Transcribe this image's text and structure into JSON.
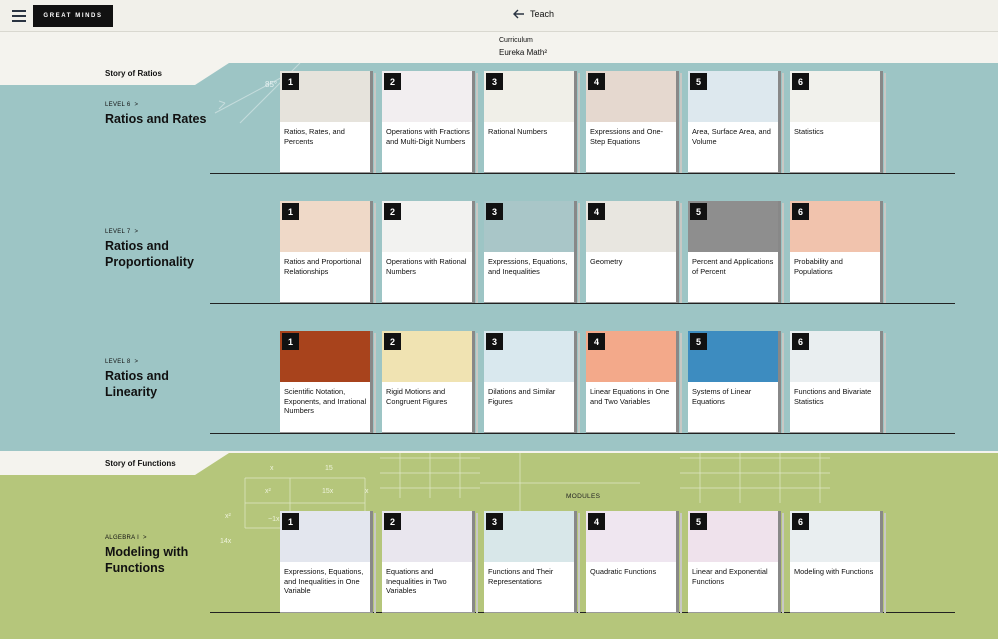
{
  "header": {
    "logo": "GREAT MINDS",
    "back_label": "Teach"
  },
  "curriculum": {
    "label": "Curriculum",
    "name": "Eureka Math²"
  },
  "stories": [
    {
      "title": "Story of Ratios",
      "color": "#9dc5c5"
    },
    {
      "title": "Story of Functions",
      "color": "#b5c67b"
    }
  ],
  "modules_label": "MODULES",
  "levels": [
    {
      "label": "LEVEL 6",
      "title": "Ratios and Rates",
      "modules": [
        {
          "num": "1",
          "title": "Ratios, Rates, and Percents"
        },
        {
          "num": "2",
          "title": "Operations with Fractions and Multi-Digit Numbers"
        },
        {
          "num": "3",
          "title": "Rational Numbers"
        },
        {
          "num": "4",
          "title": "Expressions and One-Step Equations"
        },
        {
          "num": "5",
          "title": "Area, Surface Area, and Volume"
        },
        {
          "num": "6",
          "title": "Statistics"
        }
      ]
    },
    {
      "label": "LEVEL 7",
      "title": "Ratios and Proportionality",
      "modules": [
        {
          "num": "1",
          "title": "Ratios and Proportional Relationships"
        },
        {
          "num": "2",
          "title": "Operations with Rational Numbers"
        },
        {
          "num": "3",
          "title": "Expressions, Equations, and Inequalities"
        },
        {
          "num": "4",
          "title": "Geometry"
        },
        {
          "num": "5",
          "title": "Percent and Applications of Percent"
        },
        {
          "num": "6",
          "title": "Probability and Populations"
        }
      ]
    },
    {
      "label": "LEVEL 8",
      "title": "Ratios and Linearity",
      "modules": [
        {
          "num": "1",
          "title": "Scientific Notation, Exponents, and Irrational Numbers"
        },
        {
          "num": "2",
          "title": "Rigid Motions and Congruent Figures"
        },
        {
          "num": "3",
          "title": "Dilations and Similar Figures"
        },
        {
          "num": "4",
          "title": "Linear Equations in One and Two Variables"
        },
        {
          "num": "5",
          "title": "Systems of Linear Equations"
        },
        {
          "num": "6",
          "title": "Functions and Bivariate Statistics"
        }
      ]
    },
    {
      "label": "ALGEBRA I",
      "title": "Modeling with Functions",
      "modules": [
        {
          "num": "1",
          "title": "Expressions, Equations, and Inequalities in One Variable"
        },
        {
          "num": "2",
          "title": "Equations and Inequalities in Two Variables"
        },
        {
          "num": "3",
          "title": "Functions and Their Representations"
        },
        {
          "num": "4",
          "title": "Quadratic Functions"
        },
        {
          "num": "5",
          "title": "Linear and Exponential Functions"
        },
        {
          "num": "6",
          "title": "Modeling with Functions"
        }
      ]
    }
  ]
}
